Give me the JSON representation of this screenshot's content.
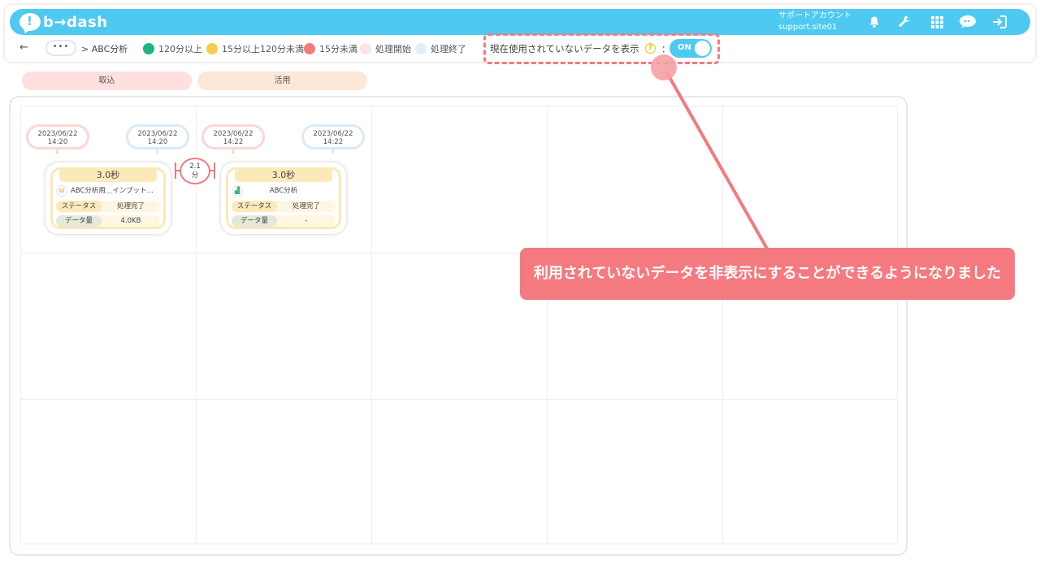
{
  "app": {
    "logo_mark": "!",
    "logo_text": "b→dash",
    "account_name": "サポートアカウント",
    "account_id": "support.site01",
    "icons": [
      "bell-icon",
      "wrench-icon",
      "grid-menu-icon",
      "chat-bubble-icon",
      "logout-icon"
    ]
  },
  "toolbar": {
    "back": "←",
    "more": "•••",
    "breadcrumb": "> ABC分析",
    "legend": [
      {
        "label": "120分以上",
        "color": "#1fb57e"
      },
      {
        "label": "15分以上120分未満",
        "color": "#f7cd4a"
      },
      {
        "label": "15分未満",
        "color": "#f47a7f"
      },
      {
        "label": "処理開始",
        "color": "#fde4e4"
      },
      {
        "label": "処理終了",
        "color": "#e3eefa"
      }
    ],
    "toggle_label": "現在使用されていないデータを表示",
    "help": "?",
    "colon": "：",
    "toggle_value": "ON"
  },
  "phases": [
    {
      "label": "取込",
      "color": "#fde0df"
    },
    {
      "label": "活用",
      "color": "#fde7d7"
    }
  ],
  "flow": {
    "step1": {
      "start": {
        "date": "2023/06/22",
        "time": "14:20"
      },
      "end": {
        "date": "2023/06/22",
        "time": "14:20"
      },
      "duration": "3.0秒",
      "icon": "import-icon",
      "name": "ABC分析用＿インプット…",
      "status_key": "ステータス",
      "status_val": "処理完了",
      "amount_key": "データ量",
      "amount_val": "4.0KB"
    },
    "interval": {
      "value": "2.1",
      "unit": "分"
    },
    "step2": {
      "start": {
        "date": "2023/06/22",
        "time": "14:22"
      },
      "end": {
        "date": "2023/06/22",
        "time": "14:22"
      },
      "duration": "3.0秒",
      "icon": "chart-icon",
      "name": "ABC分析",
      "status_key": "ステータス",
      "status_val": "処理完了",
      "amount_key": "データ量",
      "amount_val": "-"
    }
  },
  "callout": {
    "text": "利用されていないデータを非表示にすることができるようになりました"
  }
}
